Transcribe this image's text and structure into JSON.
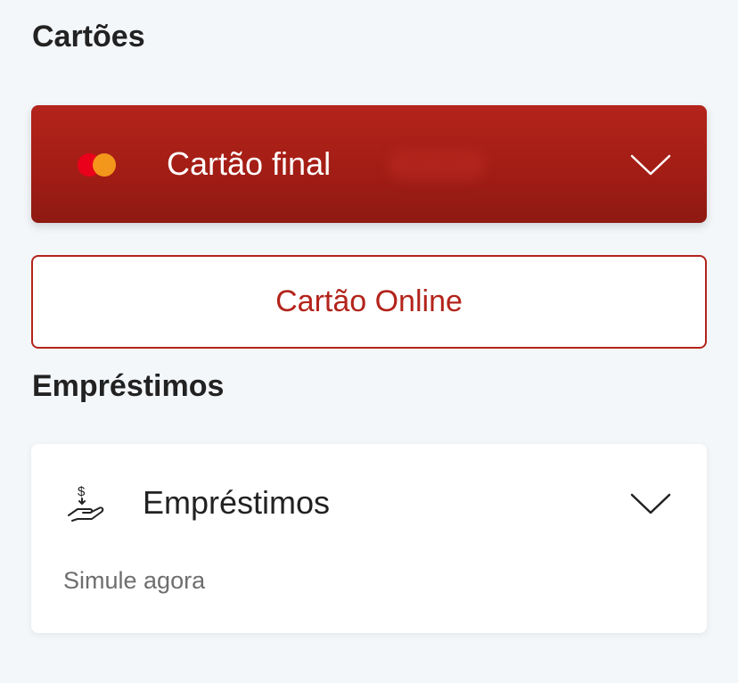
{
  "sections": {
    "cards_title": "Cartões",
    "loans_title": "Empréstimos"
  },
  "card_selector": {
    "label": "Cartão final",
    "brand_icon": "card-brand-icon",
    "chevron_icon": "chevron-down-icon",
    "background_color": "#a31d15"
  },
  "online_button": {
    "label": "Cartão Online",
    "accent_color": "#b3241b"
  },
  "loan_card": {
    "label": "Empréstimos",
    "subtitle": "Simule agora",
    "icon": "hand-money-icon",
    "chevron_icon": "chevron-down-icon"
  }
}
